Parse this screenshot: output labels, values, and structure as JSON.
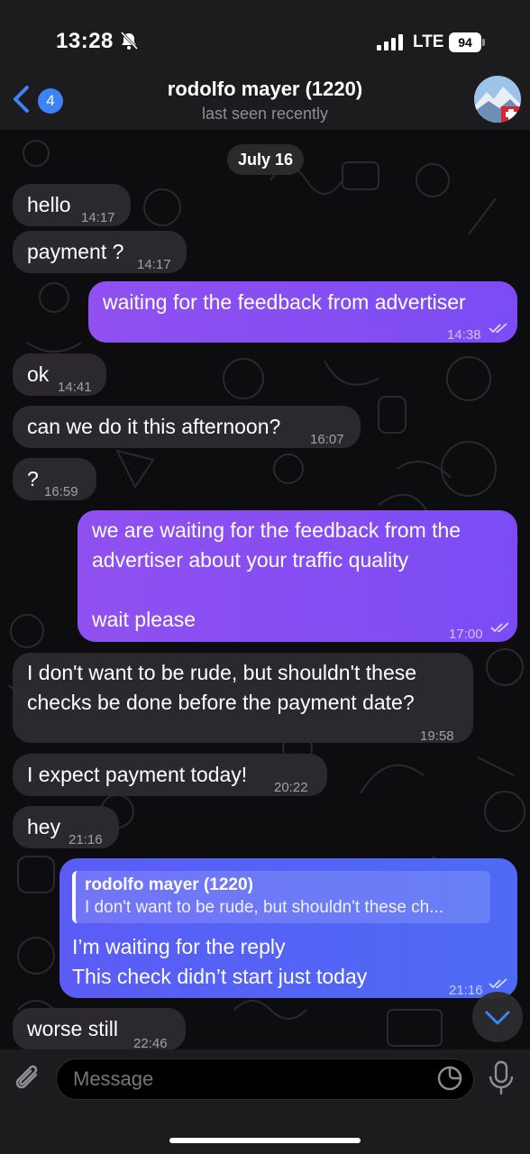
{
  "status_bar": {
    "time": "13:28",
    "carrier": "LTE",
    "battery": "94"
  },
  "header": {
    "back_badge": "4",
    "title": "rodolfo mayer (1220)",
    "subtitle": "last seen recently"
  },
  "date_separator": "July 16",
  "messages": [
    {
      "dir": "in",
      "text": "hello",
      "time": "14:17"
    },
    {
      "dir": "in",
      "text": "payment ?",
      "time": "14:17"
    },
    {
      "dir": "out",
      "text": "waiting for the feedback from advertiser",
      "time": "14:38"
    },
    {
      "dir": "in",
      "text": "ok",
      "time": "14:41"
    },
    {
      "dir": "in",
      "text": "can we do it this afternoon?",
      "time": "16:07"
    },
    {
      "dir": "in",
      "text": "?",
      "time": "16:59"
    },
    {
      "dir": "out",
      "text": "we are waiting for the feedback from the advertiser about your traffic quality\n\nwait please",
      "time": "17:00"
    },
    {
      "dir": "in",
      "text": "I don't want to be rude, but shouldn't these checks be done before the payment date?",
      "time": "19:58"
    },
    {
      "dir": "in",
      "text": "I expect payment today!",
      "time": "20:22"
    },
    {
      "dir": "in",
      "text": "hey",
      "time": "21:16"
    },
    {
      "dir": "out",
      "reply_to": {
        "name": "rodolfo mayer (1220)",
        "text": "I don't want to be rude, but shouldn't these ch..."
      },
      "text": "I’m waiting for the reply\nThis check didn’t start just today",
      "time": "21:16"
    },
    {
      "dir": "in",
      "text": "worse still",
      "time": "22:46"
    }
  ],
  "input": {
    "placeholder": "Message"
  },
  "colors": {
    "accent": "#3d82f6",
    "outgoing": "#8a4ff2",
    "outgoing_reply": "#5561f5",
    "incoming": "#2e2c30"
  },
  "icons": [
    "bell-slash-icon",
    "signal-icon",
    "battery-icon",
    "back-chevron-icon",
    "paperclip-icon",
    "sticker-icon",
    "microphone-icon",
    "chevron-down-icon",
    "double-check-icon"
  ]
}
